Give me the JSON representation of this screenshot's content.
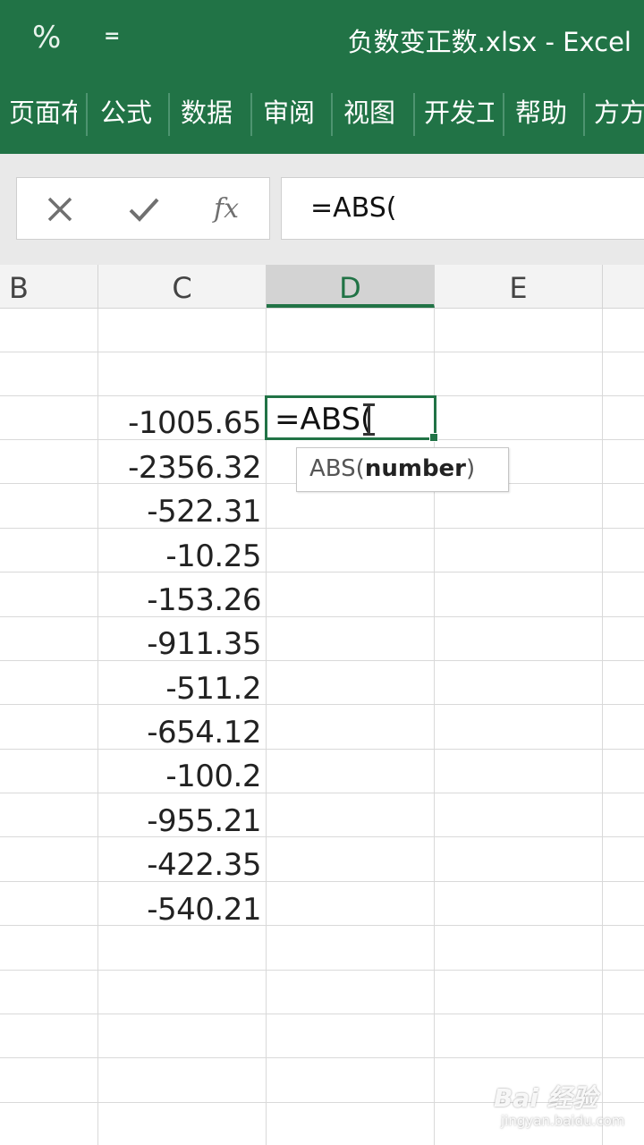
{
  "titlebar": {
    "qat_percent": "%",
    "qat_dropdown": "=",
    "title": "负数变正数.xlsx  -  Excel"
  },
  "ribbon": {
    "tabs": [
      "页面布",
      "公式",
      "数据",
      "审阅",
      "视图",
      "开发工",
      "帮助",
      "方方"
    ]
  },
  "formula_bar": {
    "cancel_icon": "close-icon",
    "enter_icon": "check-icon",
    "function_label": "fx",
    "value": "=ABS("
  },
  "columns": [
    "B",
    "C",
    "D",
    "E"
  ],
  "active_column": "D",
  "cells_c": [
    "-1005.65",
    "-2356.32",
    "-522.31",
    "-10.25",
    "-153.26",
    "-911.35",
    "-511.2",
    "-654.12",
    "-100.2",
    "-955.21",
    "-422.35",
    "-540.21"
  ],
  "active_cell": {
    "value": "=ABS("
  },
  "tooltip": {
    "prefix": "ABS(",
    "arg": "number",
    "suffix": ")"
  },
  "watermark": {
    "brand": "Bai 经验",
    "sub": "jingyan.baidu.com"
  },
  "colors": {
    "excel_green": "#217346",
    "grid_line": "#d9d9d9"
  }
}
